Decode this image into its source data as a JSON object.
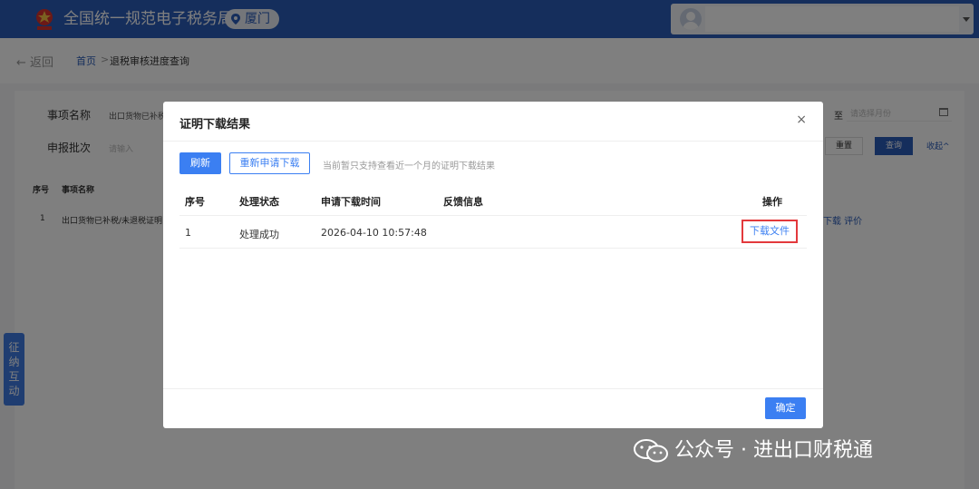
{
  "header": {
    "brand": "全国统一规范电子税务局",
    "city": "厦门"
  },
  "breadcrumb": {
    "back": "← 返回",
    "home": "首页",
    "separator": ">",
    "current": "退税审核进度查询"
  },
  "filters": {
    "item_name_label": "事项名称",
    "item_name_value": "出口货物已补税",
    "batch_label": "申报批次",
    "batch_placeholder": "请输入",
    "to_label": "至",
    "date_placeholder": "请选择月份",
    "reset": "重置",
    "query": "查询",
    "collapse": "收起^"
  },
  "background_table": {
    "headers": [
      "序号",
      "事项名称"
    ],
    "row": {
      "index": "1",
      "name": "出口货物已补税/未退税证明"
    },
    "actions": "下载 评价"
  },
  "sidetab": "征纳互动",
  "modal": {
    "title": "证明下载结果",
    "close": "×",
    "refresh": "刷新",
    "redo": "重新申请下载",
    "hint": "当前暂只支持查看近一个月的证明下载结果",
    "columns": [
      "序号",
      "处理状态",
      "申请下载时间",
      "反馈信息",
      "操作"
    ],
    "rows": [
      {
        "index": "1",
        "status": "处理成功",
        "time": "2026-04-10 10:57:48",
        "feedback": "",
        "action": "下载文件"
      }
    ],
    "ok": "确定"
  },
  "watermark": "公众号 · 进出口财税通",
  "colors": {
    "header": "#2b5cb8",
    "primary": "#3b7ff2",
    "highlight": "#e3393c"
  }
}
